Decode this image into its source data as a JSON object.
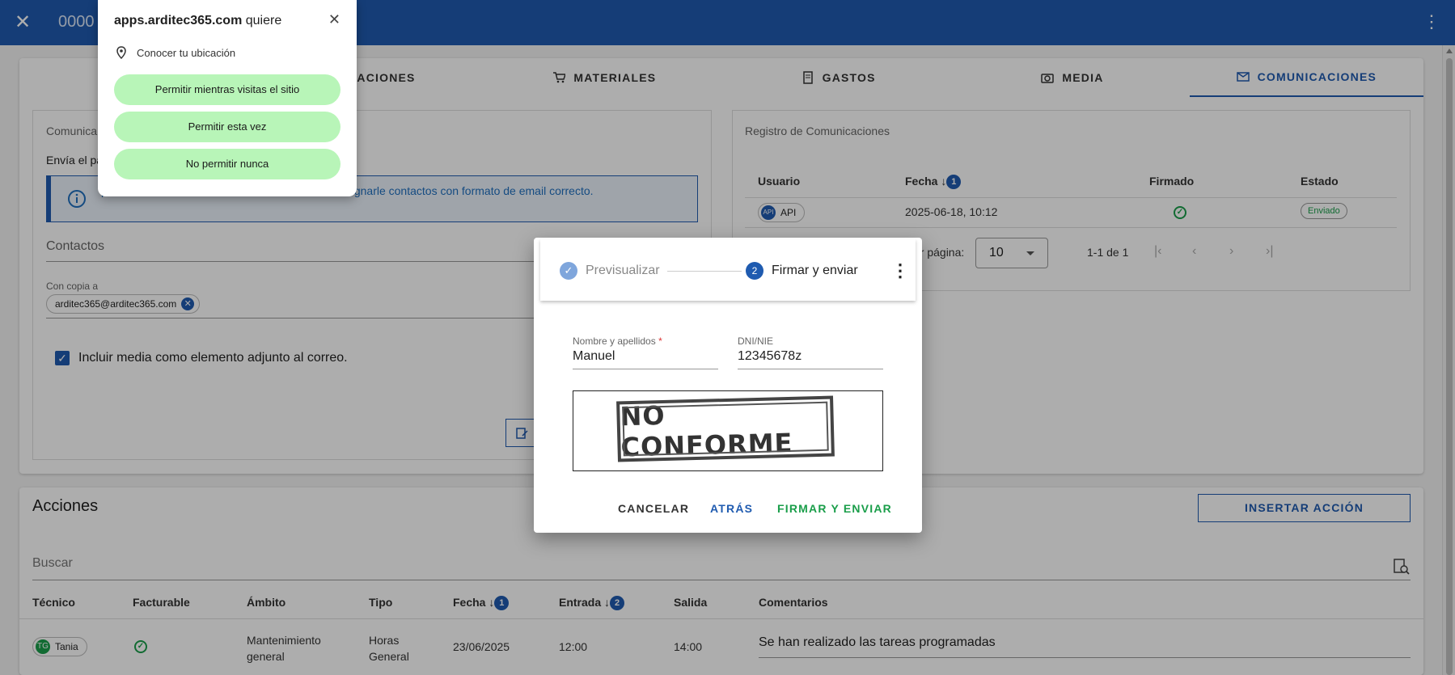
{
  "appbar": {
    "close": "✕",
    "title": "0000",
    "menu": "⋮"
  },
  "tabs": [
    {
      "label": "",
      "icon": "contact-icon"
    },
    {
      "label": "SIGNACIONES",
      "icon": ""
    },
    {
      "label": "MATERIALES",
      "icon": "cart-icon"
    },
    {
      "label": "GASTOS",
      "icon": "receipt-icon"
    },
    {
      "label": "MEDIA",
      "icon": "camera-icon"
    },
    {
      "label": "COMUNICACIONES",
      "icon": "mail-icon"
    }
  ],
  "comms": {
    "section_title": "Comunica",
    "send_text": "Envía el pa",
    "info_text": "poder enviar las comunicaciones, es necesario asignarle contactos con formato de email correcto.",
    "contacts_label": "Contactos",
    "cc_label": "Con copia a",
    "cc_chip": "arditec365@arditec365.com",
    "include_media_label": "Incluir media como elemento adjunto al correo."
  },
  "registry": {
    "title": "Registro de Comunicaciones",
    "columns": [
      "Usuario",
      "Fecha",
      "Firmado",
      "Estado"
    ],
    "sort_badge": "1",
    "row": {
      "user": "API",
      "user_avatar": "API",
      "date": "2025-06-18, 10:12",
      "status": "Enviado"
    },
    "per_page_label": "or página:",
    "per_page_value": "10",
    "range": "1-1 de 1"
  },
  "actions": {
    "title": "Acciones",
    "insert_button": "INSERTAR ACCIÓN",
    "search_placeholder": "Buscar",
    "columns": [
      "Técnico",
      "Facturable",
      "Ámbito",
      "Tipo",
      "Fecha",
      "Entrada",
      "Salida",
      "Comentarios"
    ],
    "fecha_badge": "1",
    "entrada_badge": "2",
    "row": {
      "tech_initials": "TG",
      "tech": "Tania",
      "ambito_line1": "Mantenimiento",
      "ambito_line2": "general",
      "tipo_line1": "Horas",
      "tipo_line2": "General",
      "fecha": "23/06/2025",
      "entrada": "12:00",
      "salida": "14:00",
      "comment": "Se han realizado las tareas programadas"
    }
  },
  "popup": {
    "site": "apps.arditec365.com",
    "wants": "quiere",
    "permission": "Conocer tu ubicación",
    "allow_visit": "Permitir mientras visitas el sitio",
    "allow_once": "Permitir esta vez",
    "deny": "No permitir nunca"
  },
  "dialog": {
    "step1": "Previsualizar",
    "step2_num": "2",
    "step2": "Firmar y enviar",
    "name_label": "Nombre y apellidos",
    "required_mark": "*",
    "name_value": "Manuel",
    "dni_label": "DNI/NIE",
    "dni_value": "12345678z",
    "stamp_text": "NO CONFORME",
    "cancel": "CANCELAR",
    "back": "ATRÁS",
    "sign_send": "FIRMAR Y ENVIAR"
  },
  "colors": {
    "primary": "#1f5bb0",
    "success": "#1a9e4a",
    "popup_button": "#b8f5b8"
  }
}
